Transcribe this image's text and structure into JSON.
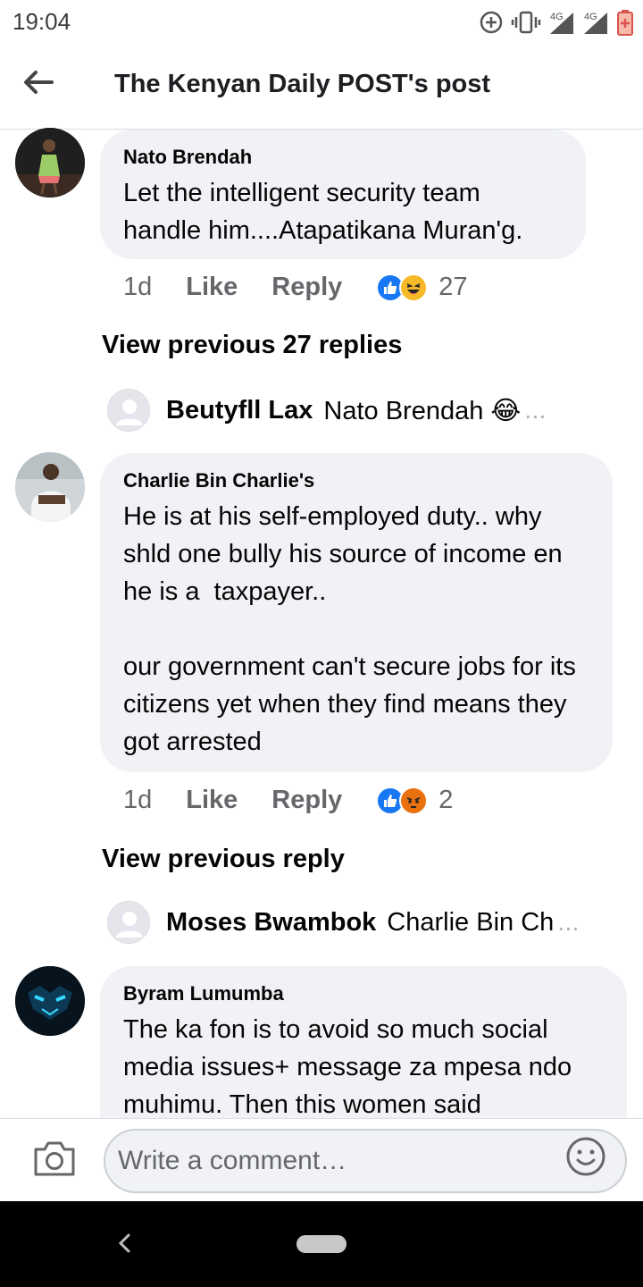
{
  "status_bar": {
    "time": "19:04",
    "network_label_1": "4G",
    "network_label_2": "4G",
    "icons": [
      "data-saver-icon",
      "vibrate-icon",
      "signal-icon",
      "signal-icon",
      "battery-low-icon"
    ]
  },
  "header": {
    "back_icon": "arrow-left-icon",
    "title": "The Kenyan Daily POST's post"
  },
  "comments": [
    {
      "author": "Nato Brendah",
      "text": "Let the intelligent security team handle him....Atapatikana Muran'g.",
      "time": "1d",
      "like_label": "Like",
      "reply_label": "Reply",
      "reactions": [
        "like",
        "haha"
      ],
      "reaction_count": "27",
      "view_previous": "View previous 27 replies",
      "reply_preview": {
        "name": "Beutyfll Lax",
        "text": "Nato Brendah 😂",
        "ellipsis": "..."
      }
    },
    {
      "author": "Charlie Bin Charlie's",
      "text": "He is at his self-employed duty.. why shld one bully his source of income en he is a  taxpayer..\n\nour government can't secure jobs for its citizens yet when they find means they got arrested",
      "time": "1d",
      "like_label": "Like",
      "reply_label": "Reply",
      "reactions": [
        "like",
        "angry"
      ],
      "reaction_count": "2",
      "view_previous": "View previous reply",
      "reply_preview": {
        "name": "Moses Bwambok",
        "text": "Charlie Bin Ch",
        "ellipsis": "..."
      }
    },
    {
      "author": "Byram Lumumba",
      "text": "The ka fon is to avoid so much social media issues+ message za mpesa ndo muhimu. Then this women said"
    }
  ],
  "composer": {
    "placeholder": "Write a comment…",
    "camera_icon": "camera-icon",
    "emoji_icon": "smiley-icon"
  },
  "colors": {
    "bubble": "#f0f2f5",
    "meta_text": "#65676b",
    "like_blue": "#1877f2",
    "haha_yellow": "#f7b928",
    "angry_orange": "#e9710f"
  }
}
